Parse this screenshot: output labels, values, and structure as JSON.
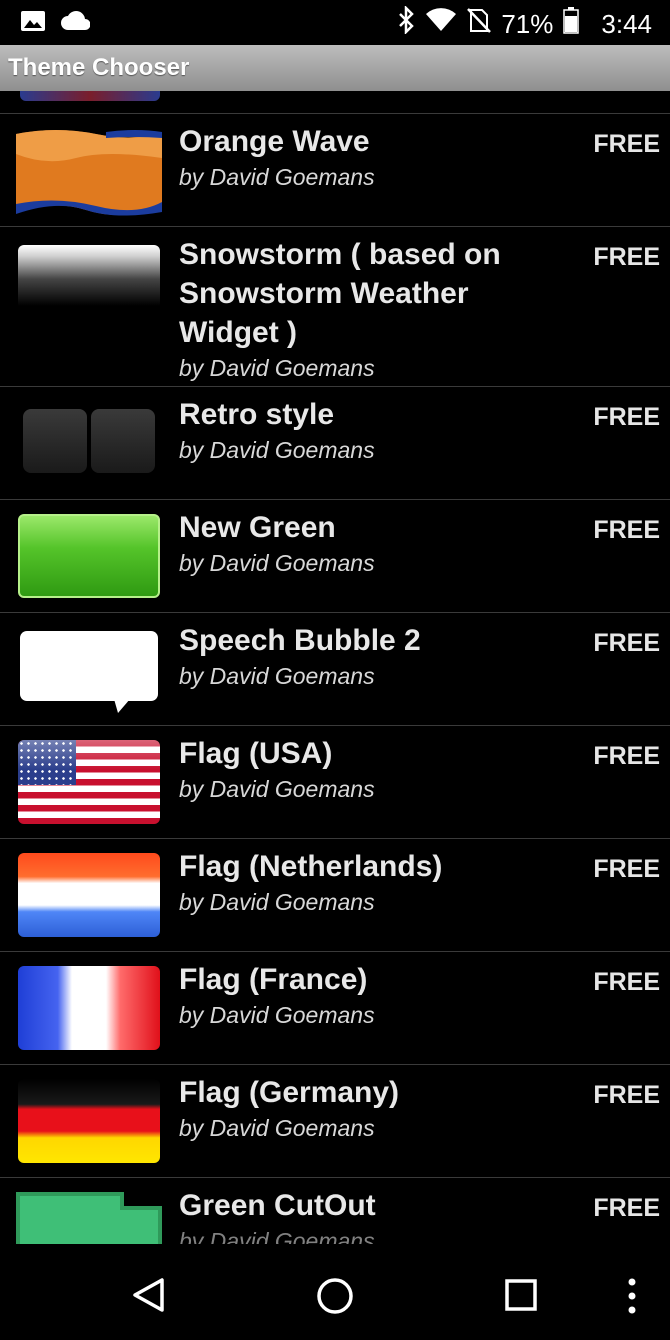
{
  "status": {
    "battery_percent": "71%",
    "time": "3:44"
  },
  "app": {
    "title": "Theme Chooser"
  },
  "themes": [
    {
      "name": "Orange Wave",
      "author": "by David Goemans",
      "price": "FREE"
    },
    {
      "name": "Snowstorm ( based on Snowstorm Weather Widget )",
      "author": "by David Goemans",
      "price": "FREE"
    },
    {
      "name": "Retro style",
      "author": "by David Goemans",
      "price": "FREE"
    },
    {
      "name": "New Green",
      "author": "by David Goemans",
      "price": "FREE"
    },
    {
      "name": "Speech Bubble 2",
      "author": "by David Goemans",
      "price": "FREE"
    },
    {
      "name": "Flag (USA)",
      "author": "by David Goemans",
      "price": "FREE"
    },
    {
      "name": "Flag (Netherlands)",
      "author": "by David Goemans",
      "price": "FREE"
    },
    {
      "name": "Flag (France)",
      "author": "by David Goemans",
      "price": "FREE"
    },
    {
      "name": "Flag (Germany)",
      "author": "by David Goemans",
      "price": "FREE"
    },
    {
      "name": "Green CutOut",
      "author": "by David Goemans",
      "price": "FREE"
    }
  ],
  "icons": {
    "status_left": [
      "image-icon",
      "cloud-icon"
    ],
    "status_right": [
      "bluetooth-icon",
      "wifi-icon",
      "no-sim-icon",
      "battery-icon"
    ],
    "nav": [
      "back-icon",
      "home-icon",
      "recents-icon",
      "overflow-menu-icon"
    ]
  }
}
